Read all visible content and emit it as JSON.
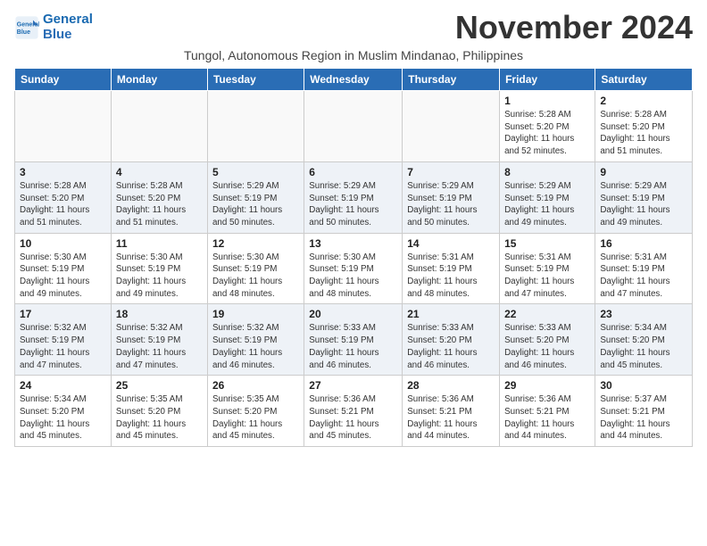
{
  "header": {
    "logo_line1": "General",
    "logo_line2": "Blue",
    "month_title": "November 2024",
    "subtitle": "Tungol, Autonomous Region in Muslim Mindanao, Philippines"
  },
  "days_of_week": [
    "Sunday",
    "Monday",
    "Tuesday",
    "Wednesday",
    "Thursday",
    "Friday",
    "Saturday"
  ],
  "weeks": [
    {
      "days": [
        {
          "num": "",
          "info": ""
        },
        {
          "num": "",
          "info": ""
        },
        {
          "num": "",
          "info": ""
        },
        {
          "num": "",
          "info": ""
        },
        {
          "num": "",
          "info": ""
        },
        {
          "num": "1",
          "info": "Sunrise: 5:28 AM\nSunset: 5:20 PM\nDaylight: 11 hours\nand 52 minutes."
        },
        {
          "num": "2",
          "info": "Sunrise: 5:28 AM\nSunset: 5:20 PM\nDaylight: 11 hours\nand 51 minutes."
        }
      ]
    },
    {
      "days": [
        {
          "num": "3",
          "info": "Sunrise: 5:28 AM\nSunset: 5:20 PM\nDaylight: 11 hours\nand 51 minutes."
        },
        {
          "num": "4",
          "info": "Sunrise: 5:28 AM\nSunset: 5:20 PM\nDaylight: 11 hours\nand 51 minutes."
        },
        {
          "num": "5",
          "info": "Sunrise: 5:29 AM\nSunset: 5:19 PM\nDaylight: 11 hours\nand 50 minutes."
        },
        {
          "num": "6",
          "info": "Sunrise: 5:29 AM\nSunset: 5:19 PM\nDaylight: 11 hours\nand 50 minutes."
        },
        {
          "num": "7",
          "info": "Sunrise: 5:29 AM\nSunset: 5:19 PM\nDaylight: 11 hours\nand 50 minutes."
        },
        {
          "num": "8",
          "info": "Sunrise: 5:29 AM\nSunset: 5:19 PM\nDaylight: 11 hours\nand 49 minutes."
        },
        {
          "num": "9",
          "info": "Sunrise: 5:29 AM\nSunset: 5:19 PM\nDaylight: 11 hours\nand 49 minutes."
        }
      ]
    },
    {
      "days": [
        {
          "num": "10",
          "info": "Sunrise: 5:30 AM\nSunset: 5:19 PM\nDaylight: 11 hours\nand 49 minutes."
        },
        {
          "num": "11",
          "info": "Sunrise: 5:30 AM\nSunset: 5:19 PM\nDaylight: 11 hours\nand 49 minutes."
        },
        {
          "num": "12",
          "info": "Sunrise: 5:30 AM\nSunset: 5:19 PM\nDaylight: 11 hours\nand 48 minutes."
        },
        {
          "num": "13",
          "info": "Sunrise: 5:30 AM\nSunset: 5:19 PM\nDaylight: 11 hours\nand 48 minutes."
        },
        {
          "num": "14",
          "info": "Sunrise: 5:31 AM\nSunset: 5:19 PM\nDaylight: 11 hours\nand 48 minutes."
        },
        {
          "num": "15",
          "info": "Sunrise: 5:31 AM\nSunset: 5:19 PM\nDaylight: 11 hours\nand 47 minutes."
        },
        {
          "num": "16",
          "info": "Sunrise: 5:31 AM\nSunset: 5:19 PM\nDaylight: 11 hours\nand 47 minutes."
        }
      ]
    },
    {
      "days": [
        {
          "num": "17",
          "info": "Sunrise: 5:32 AM\nSunset: 5:19 PM\nDaylight: 11 hours\nand 47 minutes."
        },
        {
          "num": "18",
          "info": "Sunrise: 5:32 AM\nSunset: 5:19 PM\nDaylight: 11 hours\nand 47 minutes."
        },
        {
          "num": "19",
          "info": "Sunrise: 5:32 AM\nSunset: 5:19 PM\nDaylight: 11 hours\nand 46 minutes."
        },
        {
          "num": "20",
          "info": "Sunrise: 5:33 AM\nSunset: 5:19 PM\nDaylight: 11 hours\nand 46 minutes."
        },
        {
          "num": "21",
          "info": "Sunrise: 5:33 AM\nSunset: 5:20 PM\nDaylight: 11 hours\nand 46 minutes."
        },
        {
          "num": "22",
          "info": "Sunrise: 5:33 AM\nSunset: 5:20 PM\nDaylight: 11 hours\nand 46 minutes."
        },
        {
          "num": "23",
          "info": "Sunrise: 5:34 AM\nSunset: 5:20 PM\nDaylight: 11 hours\nand 45 minutes."
        }
      ]
    },
    {
      "days": [
        {
          "num": "24",
          "info": "Sunrise: 5:34 AM\nSunset: 5:20 PM\nDaylight: 11 hours\nand 45 minutes."
        },
        {
          "num": "25",
          "info": "Sunrise: 5:35 AM\nSunset: 5:20 PM\nDaylight: 11 hours\nand 45 minutes."
        },
        {
          "num": "26",
          "info": "Sunrise: 5:35 AM\nSunset: 5:20 PM\nDaylight: 11 hours\nand 45 minutes."
        },
        {
          "num": "27",
          "info": "Sunrise: 5:36 AM\nSunset: 5:21 PM\nDaylight: 11 hours\nand 45 minutes."
        },
        {
          "num": "28",
          "info": "Sunrise: 5:36 AM\nSunset: 5:21 PM\nDaylight: 11 hours\nand 44 minutes."
        },
        {
          "num": "29",
          "info": "Sunrise: 5:36 AM\nSunset: 5:21 PM\nDaylight: 11 hours\nand 44 minutes."
        },
        {
          "num": "30",
          "info": "Sunrise: 5:37 AM\nSunset: 5:21 PM\nDaylight: 11 hours\nand 44 minutes."
        }
      ]
    }
  ]
}
